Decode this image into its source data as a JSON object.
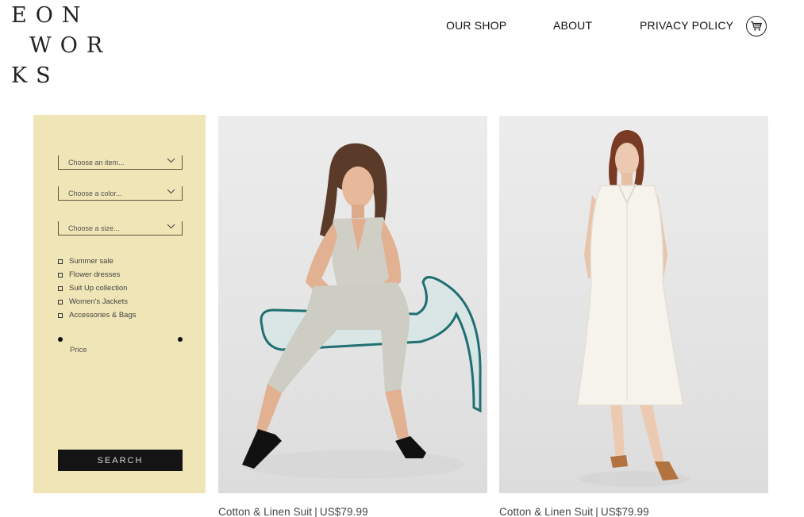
{
  "logo": {
    "line1": "EON",
    "line2": "WOR",
    "line3": "KS"
  },
  "nav": {
    "shop": "OUR SHOP",
    "about": "ABOUT",
    "privacy": "PRIVACY POLICY",
    "cart_icon": "cart-icon"
  },
  "filters": {
    "item_placeholder": "Choose an item...",
    "color_placeholder": "Choose a color...",
    "size_placeholder": "Choose a size...",
    "categories": [
      "Summer sale",
      "Flower dresses",
      "Suit Up collection",
      "Women's Jackets",
      "Accessories & Bags"
    ],
    "price_label": "Price",
    "search_label": "SEARCH"
  },
  "products": [
    {
      "name": "Cotton & Linen Suit",
      "price": "US$79.99"
    },
    {
      "name": "Cotton & Linen Suit",
      "price": "US$79.99"
    }
  ],
  "colors": {
    "sidebar_bg": "#efe5b6",
    "button_bg": "#141414",
    "photo_bg": "#e6e6e6"
  }
}
